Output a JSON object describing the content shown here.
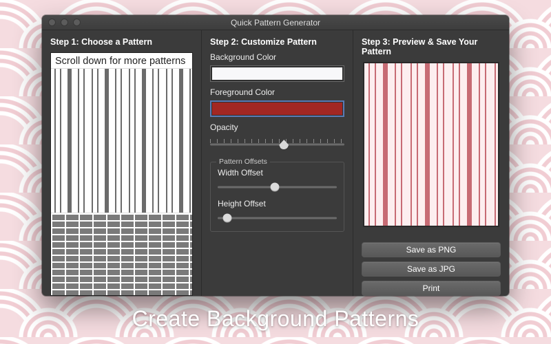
{
  "tagline": "Create Background Patterns",
  "window": {
    "title": "Quick Pattern Generator"
  },
  "step1": {
    "heading": "Step 1: Choose a Pattern",
    "scroll_note": "Scroll down for more patterns"
  },
  "step2": {
    "heading": "Step 2: Customize Pattern",
    "bg_label": "Background Color",
    "fg_label": "Foreground Color",
    "opacity_label": "Opacity",
    "opacity_percent": 55,
    "offsets_group": "Pattern Offsets",
    "width_offset_label": "Width Offset",
    "width_offset_percent": 48,
    "height_offset_label": "Height Offset",
    "height_offset_percent": 8,
    "bg_color": "#f8f8fa",
    "fg_color": "#a22723"
  },
  "step3": {
    "heading": "Step 3: Preview & Save Your Pattern",
    "save_png": "Save as PNG",
    "save_jpg": "Save as JPG",
    "print": "Print"
  }
}
